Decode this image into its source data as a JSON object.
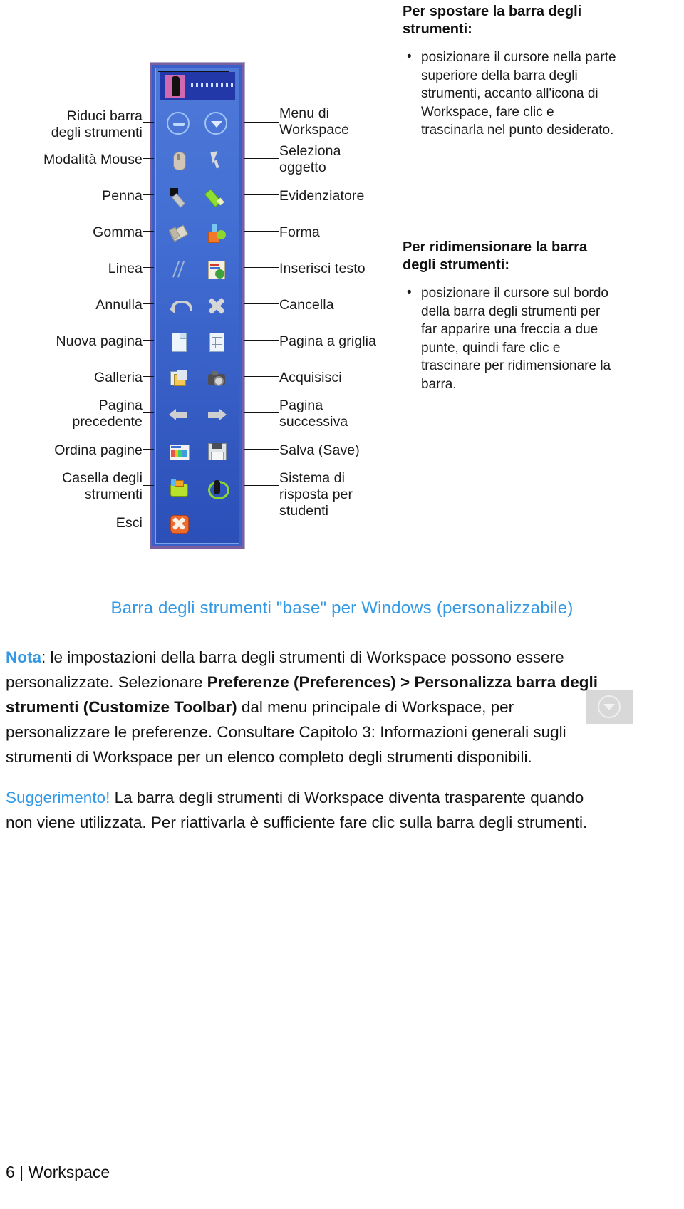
{
  "figure": {
    "toolbar": {
      "logo_name": "workspace-logo",
      "handle_dots": "drag-handle-dots",
      "rows": [
        {
          "left": {
            "icon": "collapse-toolbar-icon",
            "cls": "circ-minus"
          },
          "right": {
            "icon": "workspace-menu-icon",
            "cls": "circ-tri"
          }
        },
        {
          "left": {
            "icon": "mouse-mode-icon",
            "cls": "ico-mouse"
          },
          "right": {
            "icon": "select-object-icon",
            "cls": "ico-point"
          }
        },
        {
          "left": {
            "icon": "pen-icon",
            "cls": "ico-pen"
          },
          "right": {
            "icon": "highlighter-icon",
            "cls": "ico-hl"
          }
        },
        {
          "left": {
            "icon": "eraser-icon",
            "cls": "ico-er"
          },
          "right": {
            "icon": "shape-icon",
            "cls": "ico-shape"
          }
        },
        {
          "left": {
            "icon": "line-icon",
            "cls": "ico-line"
          },
          "right": {
            "icon": "insert-text-icon",
            "cls": "ico-text"
          }
        },
        {
          "left": {
            "icon": "undo-icon",
            "cls": "ico-undo"
          },
          "right": {
            "icon": "delete-icon",
            "cls": "ico-x"
          }
        },
        {
          "left": {
            "icon": "new-page-icon",
            "cls": "ico-np"
          },
          "right": {
            "icon": "grid-page-icon",
            "cls": "ico-gp"
          }
        },
        {
          "left": {
            "icon": "gallery-icon",
            "cls": "ico-gal"
          },
          "right": {
            "icon": "capture-icon",
            "cls": "ico-cam"
          }
        },
        {
          "left": {
            "icon": "previous-page-icon",
            "cls": "ico-back"
          },
          "right": {
            "icon": "next-page-icon",
            "cls": "ico-fwd"
          }
        },
        {
          "left": {
            "icon": "sort-pages-icon",
            "cls": "ico-sort"
          },
          "right": {
            "icon": "save-icon",
            "cls": "ico-save"
          }
        },
        {
          "left": {
            "icon": "toolbox-icon",
            "cls": "ico-tbox"
          },
          "right": {
            "icon": "student-response-system-icon",
            "cls": "ico-ink"
          }
        },
        {
          "left": {
            "icon": "exit-icon",
            "cls": "ico-exit"
          },
          "right": null
        }
      ]
    },
    "left_labels": [
      {
        "text": "Riduci barra\ndegli strumenti"
      },
      {
        "text": "Modalità Mouse"
      },
      {
        "text": "Penna"
      },
      {
        "text": "Gomma"
      },
      {
        "text": "Linea"
      },
      {
        "text": "Annulla"
      },
      {
        "text": "Nuova pagina"
      },
      {
        "text": "Galleria"
      },
      {
        "text": "Pagina\nprecedente"
      },
      {
        "text": "Ordina pagine"
      },
      {
        "text": "Casella degli\nstrumenti"
      },
      {
        "text": "Esci"
      }
    ],
    "right_labels": [
      {
        "text": "Menu di\nWorkspace"
      },
      {
        "text": "Seleziona\noggetto"
      },
      {
        "text": "Evidenziatore"
      },
      {
        "text": "Forma"
      },
      {
        "text": "Inserisci testo"
      },
      {
        "text": "Cancella"
      },
      {
        "text": "Pagina a griglia"
      },
      {
        "text": "Acquisisci"
      },
      {
        "text": "Pagina\nsuccessiva"
      },
      {
        "text": "Salva (Save)"
      },
      {
        "text": "Sistema di\nrisposta per\nstudenti"
      }
    ]
  },
  "callouts": [
    {
      "title": "Per spostare la barra degli strumenti:",
      "bullets": [
        "posizionare il cursore nella parte superiore della barra degli strumenti, accanto all'icona di Workspace, fare clic e trascinarla nel punto desiderato."
      ]
    },
    {
      "title": "Per ridimensionare la barra degli strumenti:",
      "bullets": [
        "posizionare il cursore sul bordo della barra degli strumenti per far apparire una freccia a due punte, quindi fare clic e trascinare per ridimensionare la barra."
      ]
    }
  ],
  "caption": "Barra degli strumenti \"base\" per Windows (personalizzabile)",
  "body": {
    "note_keyword": "Nota",
    "note_p1_a": ": le impostazioni della barra degli strumenti di Workspace possono essere personalizzate. Selezionare ",
    "note_bold1": "Preferenze (Preferences) > Personalizza barra degli strumenti (Customize Toolbar)",
    "note_p1_b": " dal menu principale di Workspace, per personalizzare le preferenze. Consultare Capitolo 3: Informazioni generali sugli strumenti di Workspace per un elenco completo degli strumenti disponibili.",
    "tip_keyword": "Suggerimento!",
    "tip_text": " La barra degli strumenti di Workspace diventa trasparente quando non viene utilizzata. Per riattivarla è sufficiente fare clic sulla barra degli strumenti."
  },
  "collapse_badge": {
    "icon": "collapse-badge-icon"
  },
  "footer": {
    "text": "6 | Workspace"
  },
  "colors": {
    "accent_blue": "#3399e5",
    "toolbar_blue": "#3a5fc8",
    "toolbar_border": "#7c5f9e",
    "text": "#141414"
  }
}
